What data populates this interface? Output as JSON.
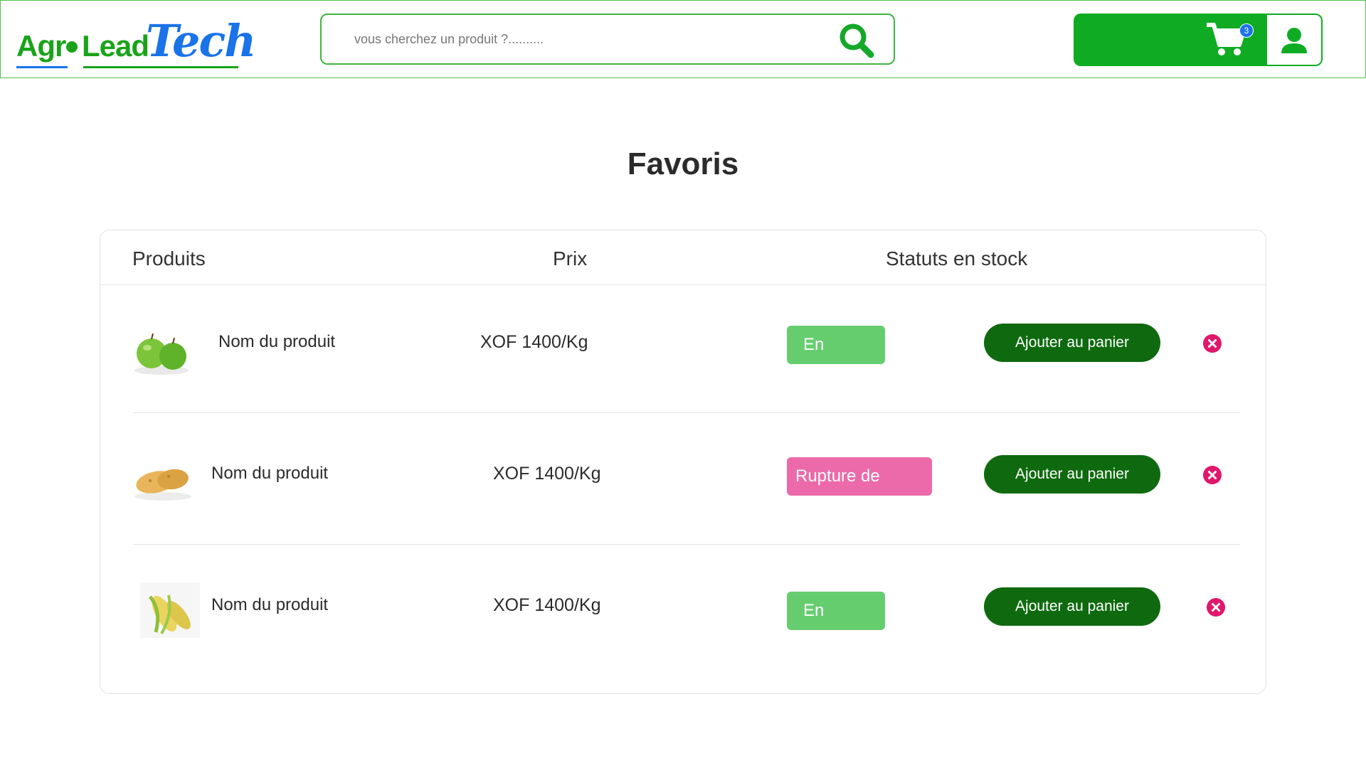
{
  "header": {
    "logo": {
      "agro": "Agr",
      "lead": "Lead",
      "tech": "Tech"
    },
    "search": {
      "placeholder": "vous cherchez un produit ?..........",
      "icon": "search-icon"
    },
    "cart": {
      "count": "3",
      "icon": "cart-icon"
    },
    "user": {
      "icon": "user-icon"
    },
    "colors": {
      "brand_green": "#0fac23",
      "brand_blue": "#1a73e8"
    }
  },
  "page": {
    "title": "Favoris"
  },
  "table": {
    "headers": {
      "products": "Produits",
      "price": "Prix",
      "status": "Statuts en stock"
    },
    "rows": [
      {
        "image": "green-apples",
        "name": "Nom du produit",
        "price": "XOF 1400/Kg",
        "status": "En stock",
        "status_kind": "in-stock",
        "action": "Ajouter au panier"
      },
      {
        "image": "potatoes",
        "name": "Nom du produit",
        "price": "XOF 1400/Kg",
        "status": "Rupture de stock",
        "status_kind": "out-of-stock",
        "action": "Ajouter au panier"
      },
      {
        "image": "corn",
        "name": "Nom du produit",
        "price": "XOF 1400/Kg",
        "status": "En stock",
        "status_kind": "in-stock",
        "action": "Ajouter au panier"
      }
    ],
    "colors": {
      "in_stock": "#66cd6f",
      "out_of_stock": "#ec6aa9",
      "button": "#0f6a0f",
      "remove": "#e0186b"
    }
  }
}
